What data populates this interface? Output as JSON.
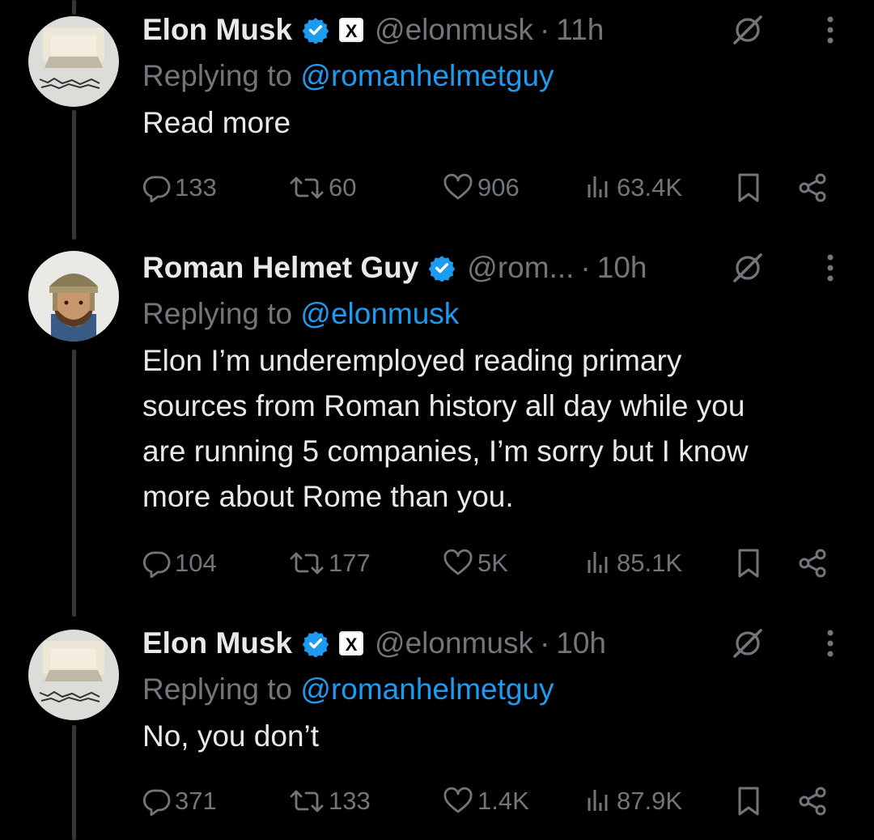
{
  "tweets": [
    {
      "name": "Elon Musk",
      "affiliation_badge": "X",
      "handle": "@elonmusk",
      "separator": "·",
      "time": "11h",
      "reply_prefix": "Replying to",
      "reply_to": "@romanhelmetguy",
      "text": [
        "Read more"
      ],
      "replies": "133",
      "reposts": "60",
      "likes": "906",
      "views": "63.4K"
    },
    {
      "name": "Roman Helmet Guy",
      "handle": "@rom...",
      "separator": "·",
      "time": "10h",
      "reply_prefix": "Replying to",
      "reply_to": "@elonmusk",
      "text": [
        "Elon I’m underemployed reading primary",
        "sources from Roman history all day while you",
        "are running 5 companies, I’m sorry but I know",
        "more about Rome than you."
      ],
      "replies": "104",
      "reposts": "177",
      "likes": "5K",
      "views": "85.1K"
    },
    {
      "name": "Elon Musk",
      "affiliation_badge": "X",
      "handle": "@elonmusk",
      "separator": "·",
      "time": "10h",
      "reply_prefix": "Replying to",
      "reply_to": "@romanhelmetguy",
      "text": [
        "No, you don’t"
      ],
      "replies": "371",
      "reposts": "133",
      "likes": "1.4K",
      "views": "87.9K"
    }
  ],
  "icons": {
    "verified": "verified-badge-icon",
    "grok": "grok-icon",
    "more": "more-options-icon",
    "reply": "reply-icon",
    "repost": "repost-icon",
    "like": "like-icon",
    "views": "views-icon",
    "bookmark": "bookmark-icon",
    "share": "share-icon"
  },
  "colors": {
    "background": "#000000",
    "text": "#e7e9ea",
    "secondary": "#71767b",
    "accent": "#1d9bf0",
    "thread_line": "#333639"
  }
}
